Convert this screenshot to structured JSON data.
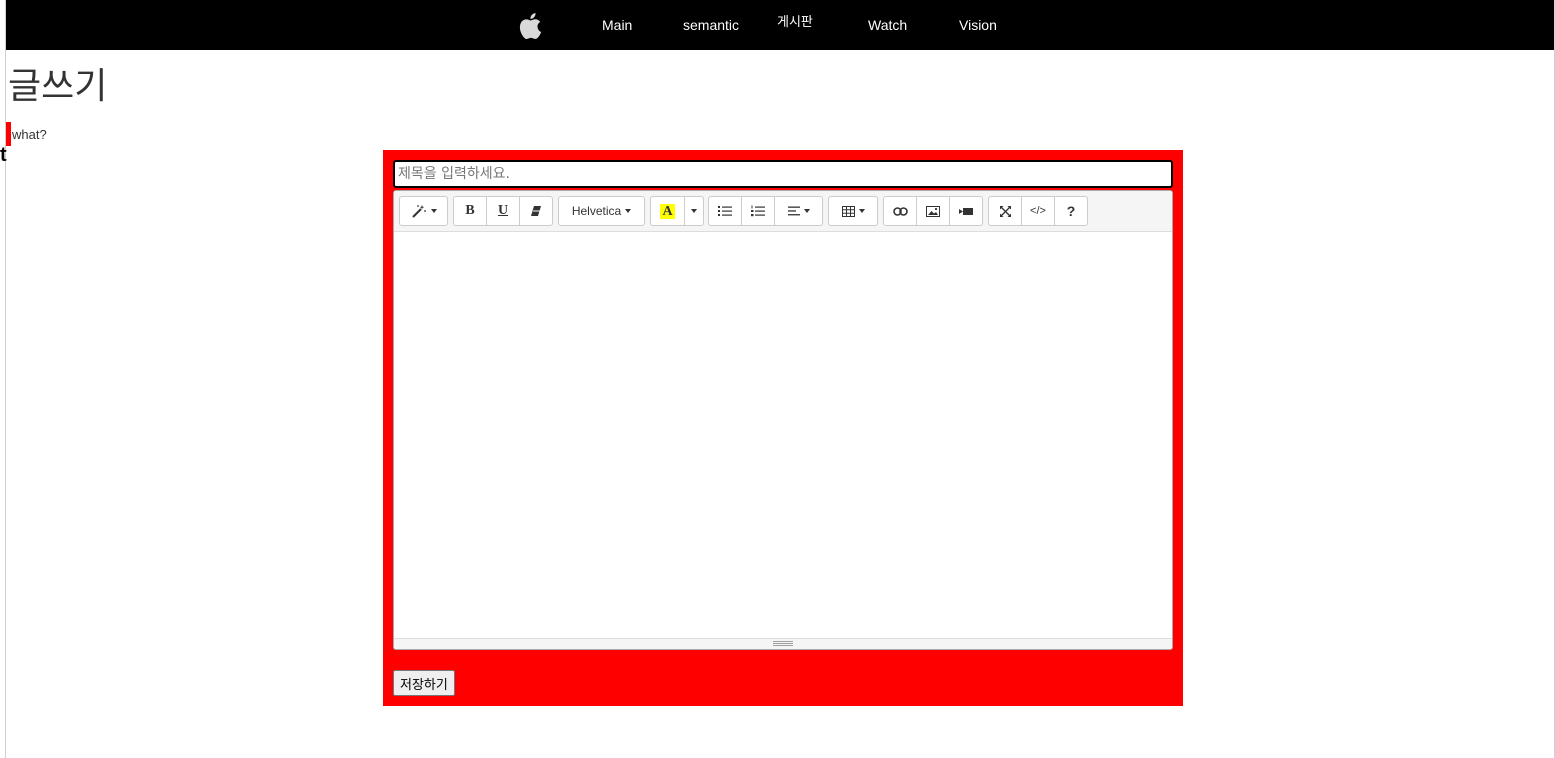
{
  "nav": {
    "items": [
      {
        "label": "Main"
      },
      {
        "label": "semantic"
      },
      {
        "label": "게시판"
      },
      {
        "label": "Watch"
      },
      {
        "label": "Vision"
      }
    ],
    "logo_icon": "apple-logo-icon"
  },
  "page": {
    "title": "글쓰기",
    "subtext": "what?",
    "partial_letter": "t"
  },
  "form": {
    "title_placeholder": "제목을 입력하세요.",
    "title_value": "",
    "save_label": "저장하기",
    "background_color": "#ff0000"
  },
  "toolbar": {
    "font_name": "Helvetica",
    "highlight_letter": "A",
    "help_label": "?",
    "code_view_label": "</>",
    "bold_label": "B",
    "underline_label": "U",
    "icons": [
      "magic-style-icon",
      "bold-icon",
      "underline-icon",
      "eraser-icon",
      "font-name-dropdown",
      "highlight-color-icon",
      "color-dropdown-icon",
      "unordered-list-icon",
      "ordered-list-icon",
      "paragraph-align-icon",
      "table-icon",
      "link-icon",
      "image-icon",
      "video-icon",
      "fullscreen-icon",
      "code-view-icon",
      "help-icon"
    ]
  }
}
